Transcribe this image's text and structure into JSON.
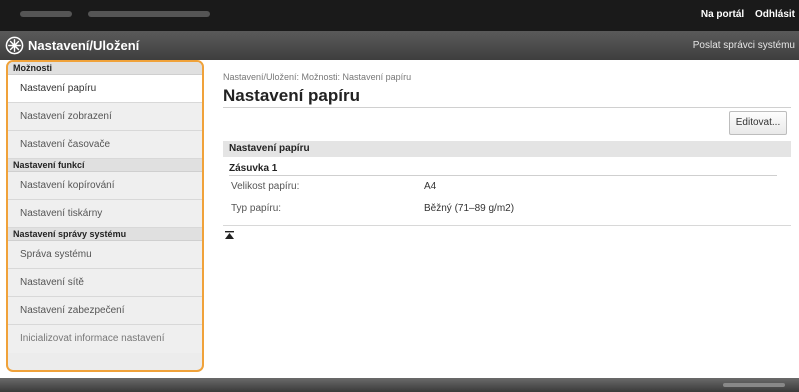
{
  "topbar": {
    "links": {
      "portal": "Na portál",
      "logout": "Odhlásit"
    }
  },
  "titlebar": {
    "icon": "settings-registration-icon",
    "title": "Nastavení/Uložení",
    "admin_link": "Poslat správci systému"
  },
  "sidebar": {
    "groups": [
      {
        "heading": "Možnosti",
        "items": [
          "Nastavení papíru",
          "Nastavení zobrazení",
          "Nastavení časovače"
        ]
      },
      {
        "heading": "Nastavení funkcí",
        "items": [
          "Nastavení kopírování",
          "Nastavení tiskárny"
        ]
      },
      {
        "heading": "Nastavení správy systému",
        "items": [
          "Správa systému",
          "Nastavení sítě",
          "Nastavení zabezpečení"
        ]
      }
    ],
    "footer_item": "Inicializovat informace nastavení",
    "active_item": "Nastavení papíru",
    "highlight_color": "#f0a23a"
  },
  "main": {
    "breadcrumb": "Nastavení/Uložení: Možnosti: Nastavení papíru",
    "title": "Nastavení papíru",
    "edit_button": "Editovat...",
    "section_heading": "Nastavení papíru",
    "drawer": {
      "title": "Zásuvka 1",
      "rows": [
        {
          "label": "Velikost papíru:",
          "value": "A4"
        },
        {
          "label": "Typ papíru:",
          "value": "Běžný (71–89 g/m2)"
        }
      ]
    },
    "to_top_icon": "to-top-icon"
  }
}
